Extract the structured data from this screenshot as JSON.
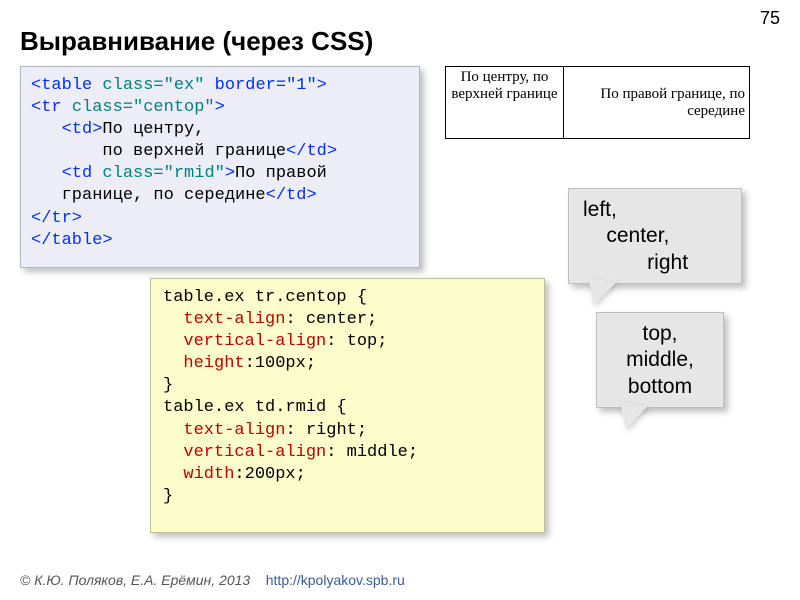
{
  "slide_number": "75",
  "title": "Выравнивание (через CSS)",
  "html_code": {
    "l1a": "<table ",
    "l1b": "class=\"ex\"",
    "l1c": " border=\"1\">",
    "l2a": "<tr ",
    "l2b": "class=\"centop\"",
    "l2c": ">",
    "l3a": "   <td>",
    "l3b": "По центру,",
    "l4": "       по верхней границе",
    "l4b": "</td>",
    "l5a": "   <td ",
    "l5b": "class=\"rmid\"",
    "l5c": ">",
    "l5d": "По правой",
    "l6": "   границе, по середине",
    "l6b": "</td>",
    "l7": "</tr>",
    "l8": "</table>"
  },
  "css_code": {
    "l1": "table.ex tr.centop {",
    "l2a": "  ",
    "l2b": "text-align",
    "l2c": ": center;",
    "l3a": "  ",
    "l3b": "vertical-align",
    "l3c": ": top;",
    "l4a": "  ",
    "l4b": "height",
    "l4c": ":100px;",
    "l5": "}",
    "l6": "table.ex td.rmid {",
    "l7a": "  ",
    "l7b": "text-align",
    "l7c": ": right;",
    "l8a": "  ",
    "l8b": "vertical-align",
    "l8c": ": middle;",
    "l9a": "  ",
    "l9b": "width",
    "l9c": ":200px;",
    "l10": "}"
  },
  "example": {
    "cell1": "По центру, по верхней границе",
    "cell2": "По правой границе, по середине"
  },
  "bubble1": "left,\n    center,\n           right",
  "bubble2": "top,\nmiddle,\nbottom",
  "footer": {
    "authors": "© К.Ю. Поляков, Е.А. Ерёмин, 2013",
    "url": "http://kpolyakov.spb.ru"
  }
}
